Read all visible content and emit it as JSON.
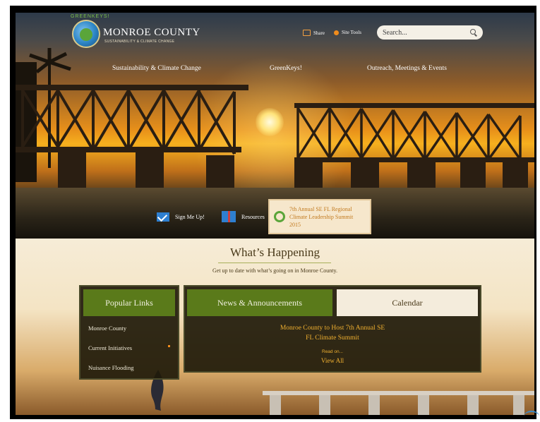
{
  "header": {
    "logo_arc_text": "GREENKEYS!",
    "site_title": "MONROE COUNTY",
    "site_subtitle": "SUSTAINABILITY & CLIMATE CHANGE",
    "share_label": "Share",
    "site_tools_label": "Site Tools",
    "search_placeholder": "Search..."
  },
  "nav": {
    "items": [
      {
        "label": "Sustainability & Climate Change"
      },
      {
        "label": "GreenKeys!"
      },
      {
        "label": "Outreach, Meetings & Events"
      }
    ]
  },
  "quick_links": {
    "sign_up": "Sign Me Up!",
    "resources": "Resources",
    "summit_line1": "7th Annual SE FL Regional",
    "summit_line2": "Climate Leadership Summit 2015"
  },
  "whats_happening": {
    "title": "What’s Happening",
    "subtitle": "Get up to date with what’s going on in Monroe County."
  },
  "popular_links": {
    "heading": "Popular Links",
    "items": [
      {
        "label": "Monroe County"
      },
      {
        "label": "Current Initiatives"
      },
      {
        "label": "Nuisance Flooding"
      }
    ]
  },
  "news": {
    "tab_news": "News & Announcements",
    "tab_calendar": "Calendar",
    "headline_line1": "Monroe County to Host 7th Annual SE",
    "headline_line2": "FL Climate Summit",
    "read_on": "Read on...",
    "view_all": "View All"
  },
  "colors": {
    "accent_green": "#5a7a1a",
    "accent_orange": "#f0b030",
    "panel_dark": "#201a0a"
  }
}
